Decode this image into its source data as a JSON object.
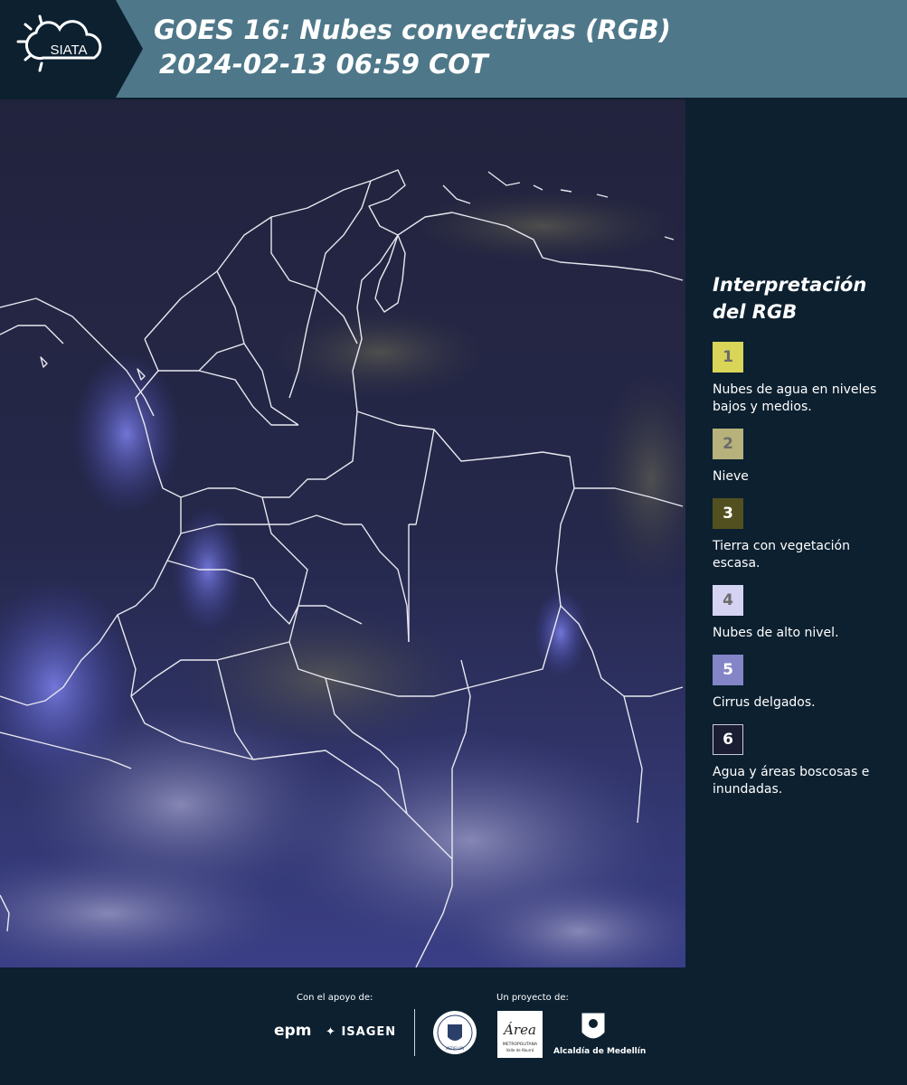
{
  "header": {
    "logo_text": "SIATA",
    "title_line1": "GOES 16: Nubes convectivas (RGB)",
    "title_line2": "2024-02-13 06:59 COT"
  },
  "legend": {
    "title_line1": "Interpretación",
    "title_line2": "del RGB",
    "items": [
      {
        "number": "1",
        "color": "#d8d558",
        "text_color": "#6b6b6b",
        "description": "Nubes de agua en niveles bajos y medios."
      },
      {
        "number": "2",
        "color": "#b7b27b",
        "text_color": "#6b6b6b",
        "description": "Nieve"
      },
      {
        "number": "3",
        "color": "#52501e",
        "text_color": "#ffffff",
        "description": "Tierra con vegetación escasa."
      },
      {
        "number": "4",
        "color": "#d5d3f2",
        "text_color": "#6b6b6b",
        "description": "Nubes de alto nivel."
      },
      {
        "number": "5",
        "color": "#8385c6",
        "text_color": "#ffffff",
        "description": "Cirrus delgados."
      },
      {
        "number": "6",
        "color": "#1a1d33",
        "text_color": "#ffffff",
        "description": "Agua y áreas boscosas e inundadas."
      }
    ]
  },
  "footer": {
    "support_label": "Con el apoyo de:",
    "project_label": "Un proyecto de:",
    "epm": "epm",
    "isagen": "ISAGEN",
    "area_text": "Área",
    "area_sub": "METROPOLITANA",
    "area_sub2": "Valle de Aburrá",
    "alcaldia": "Alcaldía de Medellín",
    "seal_text": "MEDELLÍN"
  },
  "colors": {
    "header_bg": "#4e7889",
    "page_bg": "#0c2030",
    "map_bg": "#222541"
  }
}
